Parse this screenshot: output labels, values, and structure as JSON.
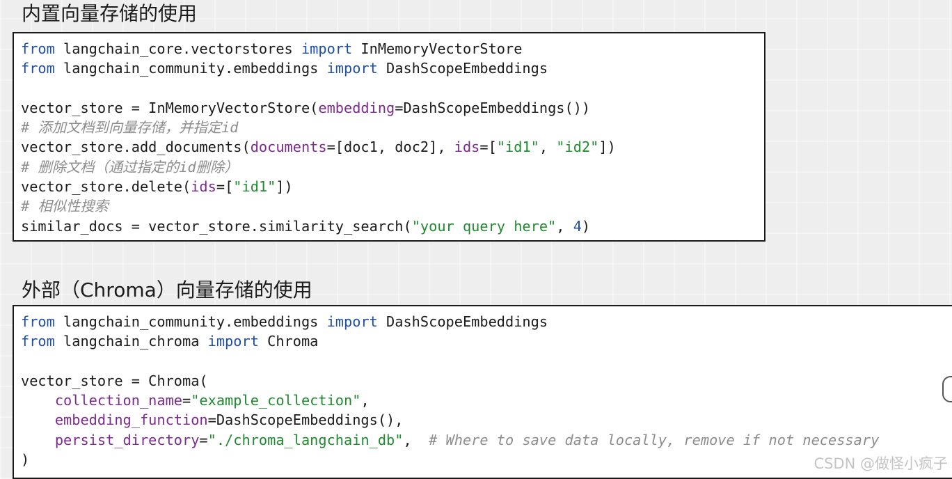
{
  "sections": {
    "builtin": {
      "title": "内置向量存储的使用"
    },
    "external": {
      "title": "外部（Chroma）向量存储的使用"
    }
  },
  "code1": {
    "l1": {
      "kw1": "from",
      "mod": " langchain_core.vectorstores ",
      "kw2": "import",
      "name": " InMemoryVectorStore"
    },
    "l2": {
      "kw1": "from",
      "mod": " langchain_community.embeddings ",
      "kw2": "import",
      "name": " DashScopeEmbeddings"
    },
    "l4": {
      "a": "vector_store = InMemoryVectorStore(",
      "p": "embedding",
      "b": "=DashScopeEmbeddings())"
    },
    "l5": {
      "comment": "# 添加文档到向量存储，并指定id"
    },
    "l6": {
      "a": "vector_store.add_documents(",
      "p1": "documents",
      "b": "=[doc1, doc2], ",
      "p2": "ids",
      "c": "=[",
      "s1": "\"id1\"",
      "d": ", ",
      "s2": "\"id2\"",
      "e": "])"
    },
    "l7": {
      "comment": "# 删除文档（通过指定的id删除）"
    },
    "l8": {
      "a": "vector_store.delete(",
      "p": "ids",
      "b": "=[",
      "s": "\"id1\"",
      "c": "])"
    },
    "l9": {
      "comment": "# 相似性搜索"
    },
    "l10": {
      "a": "similar_docs = vector_store.similarity_search(",
      "s": "\"your query here\"",
      "b": ", ",
      "n": "4",
      "c": ")"
    }
  },
  "code2": {
    "l1": {
      "kw1": "from",
      "mod": " langchain_community.embeddings ",
      "kw2": "import",
      "name": " DashScopeEmbeddings"
    },
    "l2": {
      "kw1": "from",
      "mod": " langchain_chroma ",
      "kw2": "import",
      "name": " Chroma"
    },
    "l4": {
      "a": "vector_store = Chroma("
    },
    "l5": {
      "p": "collection_name",
      "b": "=",
      "s": "\"example_collection\"",
      "c": ","
    },
    "l6": {
      "p": "embedding_function",
      "b": "=DashScopeEmbeddings(),"
    },
    "l7": {
      "p": "persist_directory",
      "b": "=",
      "s": "\"./chroma_langchain_db\"",
      "c": ",  ",
      "comment": "# Where to save data locally, remove if not necessary"
    },
    "l8": {
      "a": ")"
    }
  },
  "watermark": "CSDN @做怪小疯子"
}
